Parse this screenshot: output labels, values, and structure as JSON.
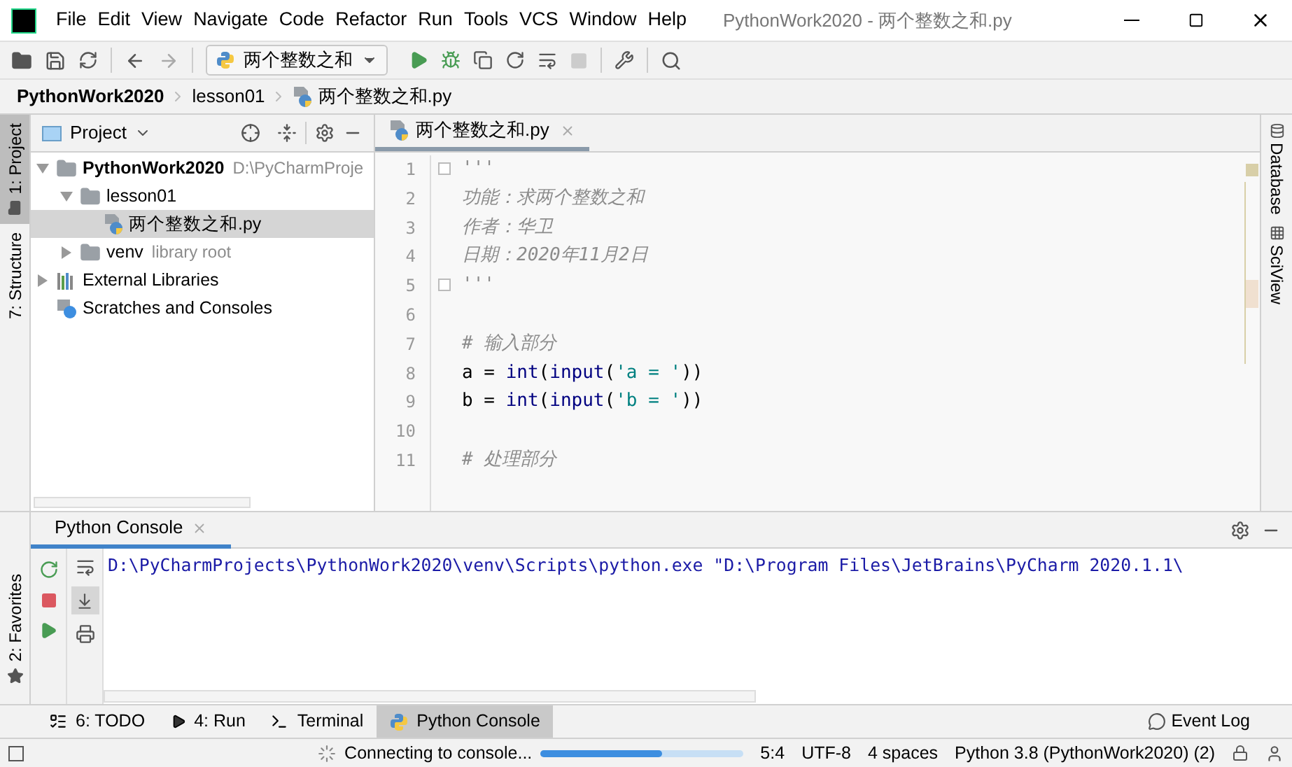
{
  "window": {
    "title": "PythonWork2020 - 两个整数之和.py"
  },
  "menu": [
    "File",
    "Edit",
    "View",
    "Navigate",
    "Code",
    "Refactor",
    "Run",
    "Tools",
    "VCS",
    "Window",
    "Help"
  ],
  "run_config": {
    "label": "两个整数之和"
  },
  "breadcrumb": [
    "PythonWork2020",
    "lesson01",
    "两个整数之和.py"
  ],
  "left_strip": [
    {
      "label": "1: Project",
      "selected": true
    },
    {
      "label": "7: Structure",
      "selected": false
    }
  ],
  "project_panel": {
    "title": "Project",
    "tree": [
      {
        "label": "PythonWork2020",
        "note": "D:\\PyCharmProje",
        "kind": "folder",
        "bold": true,
        "expanded": true,
        "selected": false,
        "children": [
          {
            "label": "lesson01",
            "kind": "folder",
            "expanded": true,
            "selected": false,
            "children": [
              {
                "label": "两个整数之和.py",
                "kind": "pyfile",
                "selected": true
              }
            ]
          },
          {
            "label": "venv",
            "note": "library root",
            "kind": "folder",
            "expanded": false,
            "selected": false
          }
        ]
      },
      {
        "label": "External Libraries",
        "kind": "libraries",
        "expanded": false,
        "selected": false
      },
      {
        "label": "Scratches and Consoles",
        "kind": "scratches",
        "selected": false
      }
    ]
  },
  "editor": {
    "tab": "两个整数之和.py",
    "lines": [
      {
        "number": "1",
        "fold": true,
        "tokens": [
          {
            "text": "'''",
            "kind": "docstring"
          }
        ]
      },
      {
        "number": "2",
        "tokens": [
          {
            "text": "功能：求两个整数之和",
            "kind": "docstring"
          }
        ]
      },
      {
        "number": "3",
        "tokens": [
          {
            "text": "作者：华卫",
            "kind": "docstring"
          }
        ]
      },
      {
        "number": "4",
        "tokens": [
          {
            "text": "日期：2020年11月2日",
            "kind": "docstring"
          }
        ]
      },
      {
        "number": "5",
        "fold": true,
        "tokens": [
          {
            "text": "'''",
            "kind": "docstring"
          }
        ]
      },
      {
        "number": "6"
      },
      {
        "number": "7",
        "tokens": [
          {
            "text": "# 输入部分",
            "kind": "comment"
          }
        ]
      },
      {
        "number": "8",
        "tokens": [
          {
            "text": "a = ",
            "kind": "plain"
          },
          {
            "text": "int",
            "kind": "builtin"
          },
          {
            "text": "(",
            "kind": "plain"
          },
          {
            "text": "input",
            "kind": "builtin"
          },
          {
            "text": "(",
            "kind": "plain"
          },
          {
            "text": "'a = '",
            "kind": "string"
          },
          {
            "text": "))",
            "kind": "plain"
          }
        ]
      },
      {
        "number": "9",
        "tokens": [
          {
            "text": "b = ",
            "kind": "plain"
          },
          {
            "text": "int",
            "kind": "builtin"
          },
          {
            "text": "(",
            "kind": "plain"
          },
          {
            "text": "input",
            "kind": "builtin"
          },
          {
            "text": "(",
            "kind": "plain"
          },
          {
            "text": "'b = '",
            "kind": "string"
          },
          {
            "text": "))",
            "kind": "plain"
          }
        ]
      },
      {
        "number": "10"
      },
      {
        "number": "11",
        "tokens": [
          {
            "text": "# 处理部分",
            "kind": "comment"
          }
        ]
      }
    ]
  },
  "right_strip": [
    "Database",
    "SciView"
  ],
  "console": {
    "title": "Python Console",
    "favorites": "2: Favorites",
    "output": "D:\\PyCharmProjects\\PythonWork2020\\venv\\Scripts\\python.exe \"D:\\Program Files\\JetBrains\\PyCharm 2020.1.1\\"
  },
  "tool_tabs": [
    {
      "label": "6: TODO",
      "kind": "todo",
      "selected": false
    },
    {
      "label": "4: Run",
      "kind": "run",
      "selected": false
    },
    {
      "label": "Terminal",
      "kind": "terminal",
      "selected": false
    },
    {
      "label": "Python Console",
      "kind": "console",
      "selected": true
    }
  ],
  "event_log": "Event Log",
  "status_bar": {
    "task": "Connecting to console...",
    "level": 0.6,
    "position": "5:4",
    "encoding": "UTF-8",
    "indent": "4 spaces",
    "interpreter": "Python 3.8 (PythonWork2020) (2)"
  }
}
